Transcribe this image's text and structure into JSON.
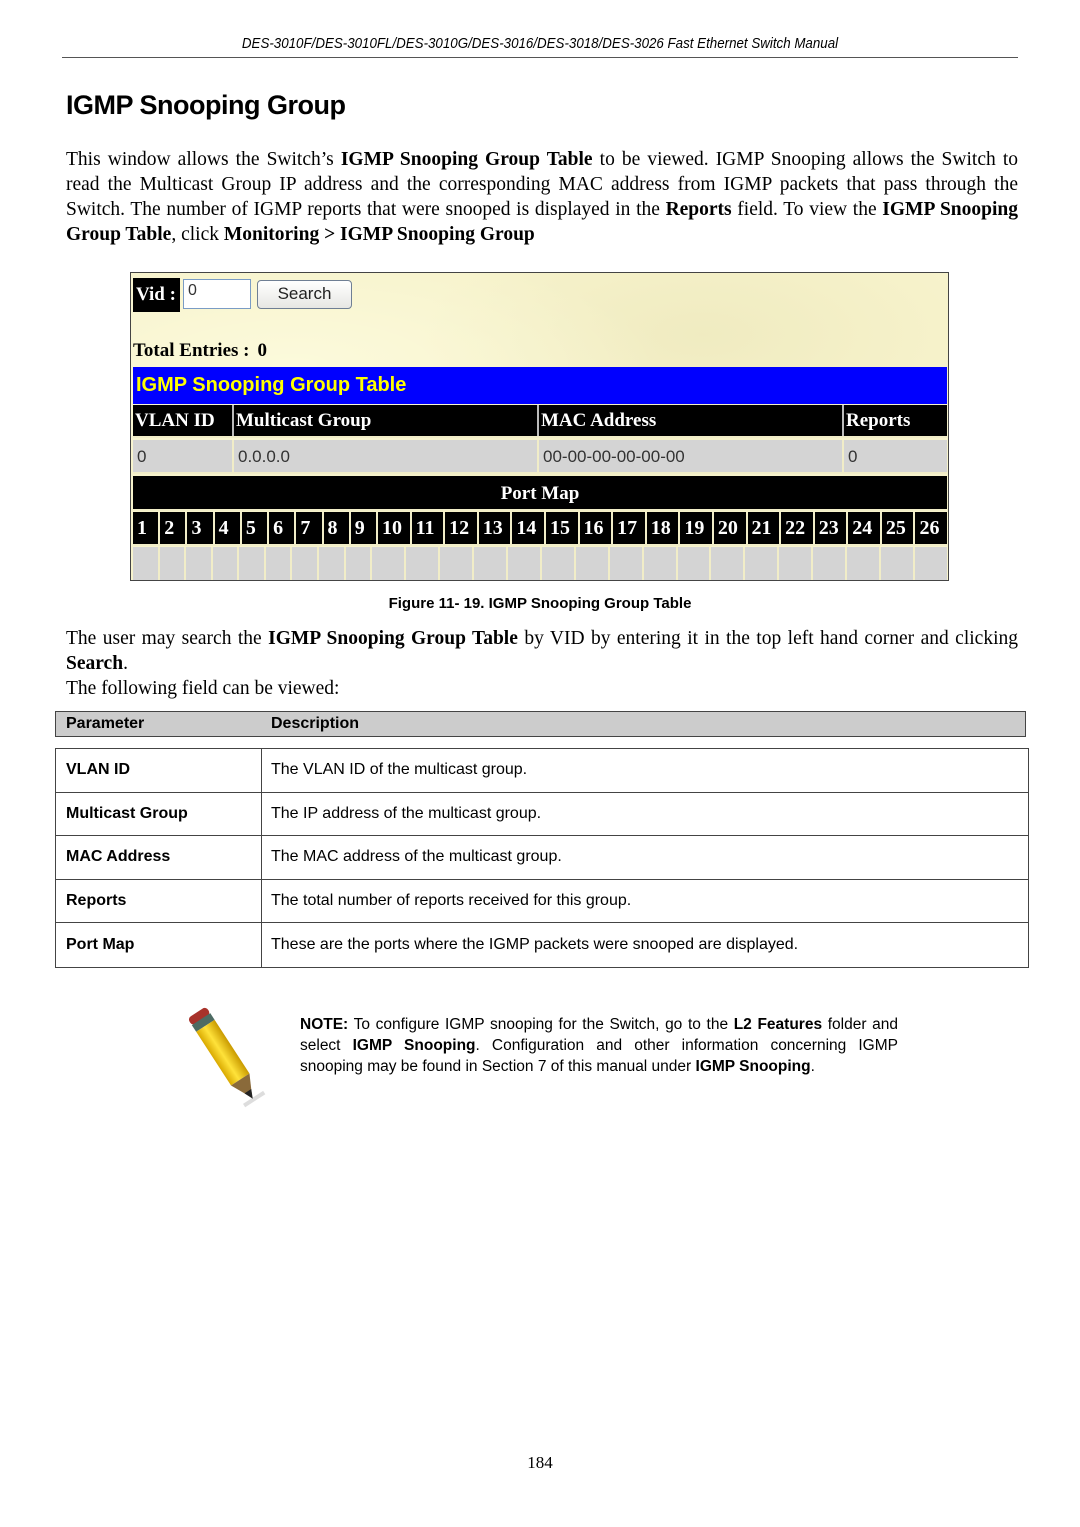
{
  "running_header": "DES-3010F/DES-3010FL/DES-3010G/DES-3016/DES-3018/DES-3026 Fast Ethernet Switch Manual",
  "page_title": "IGMP Snooping Group",
  "intro": {
    "t1": "This window allows the Switch’s ",
    "b1": "IGMP Snooping Group Table",
    "t2": " to be viewed. IGMP Snooping allows the Switch to read the Multicast Group IP address and the corresponding MAC address from IGMP packets that pass through the Switch. The number of IGMP reports that were snooped is displayed in the ",
    "b2": "Reports",
    "t3": " field. To view the ",
    "b3": "IGMP Snooping Group Table",
    "t4": ", click ",
    "b4": "Monitoring > IGMP Snooping Group"
  },
  "figure": {
    "vid_label": "Vid :",
    "vid_value": "0",
    "search_label": "Search",
    "total_entries_label": "Total Entries :",
    "total_entries_value": "0",
    "table_title": "IGMP Snooping Group Table",
    "columns": [
      "VLAN ID",
      "Multicast Group",
      "MAC Address",
      "Reports"
    ],
    "row": [
      "0",
      "0.0.0.0",
      "00-00-00-00-00-00",
      "0"
    ],
    "port_map_label": "Port Map",
    "ports": [
      "1",
      "2",
      "3",
      "4",
      "5",
      "6",
      "7",
      "8",
      "9",
      "10",
      "11",
      "12",
      "13",
      "14",
      "15",
      "16",
      "17",
      "18",
      "19",
      "20",
      "21",
      "22",
      "23",
      "24",
      "25",
      "26"
    ],
    "colors": {
      "title_bg": "#0000ff",
      "title_fg": "#ffff00",
      "header_bg": "#000000",
      "data_bg": "#d4d4d4",
      "page_bg": "#f7f3cc"
    }
  },
  "caption": "Figure 11- 19. IGMP Snooping Group Table",
  "after": {
    "t1": "The user may search the ",
    "b1": "IGMP Snooping Group Table",
    "t2": " by VID by entering it in the top left hand corner and clicking ",
    "b2": "Search",
    "t3": ".",
    "line2": "The following field can be viewed:"
  },
  "param_table": {
    "headers": [
      "Parameter",
      "Description"
    ],
    "rows": [
      {
        "name": "VLAN ID",
        "desc": "The VLAN ID of the multicast group."
      },
      {
        "name": "Multicast Group",
        "desc": "The IP address of the multicast group."
      },
      {
        "name": "MAC Address",
        "desc": "The MAC address of the multicast group."
      },
      {
        "name": "Reports",
        "desc": "The total number of reports received for this group."
      },
      {
        "name": "Port Map",
        "desc": "These are the ports where the IGMP packets were snooped are displayed."
      }
    ]
  },
  "note": {
    "icon": "pencil-icon",
    "label": "NOTE:",
    "t1": " To configure IGMP snooping for the Switch, go to the ",
    "b1": "L2 Features",
    "t2": " folder and select ",
    "b2": "IGMP Snooping",
    "t3": ". Configuration and other information concerning IGMP snooping may be found in Section 7 of this manual under ",
    "b3": "IGMP Snooping",
    "t4": "."
  },
  "page_number": "184"
}
